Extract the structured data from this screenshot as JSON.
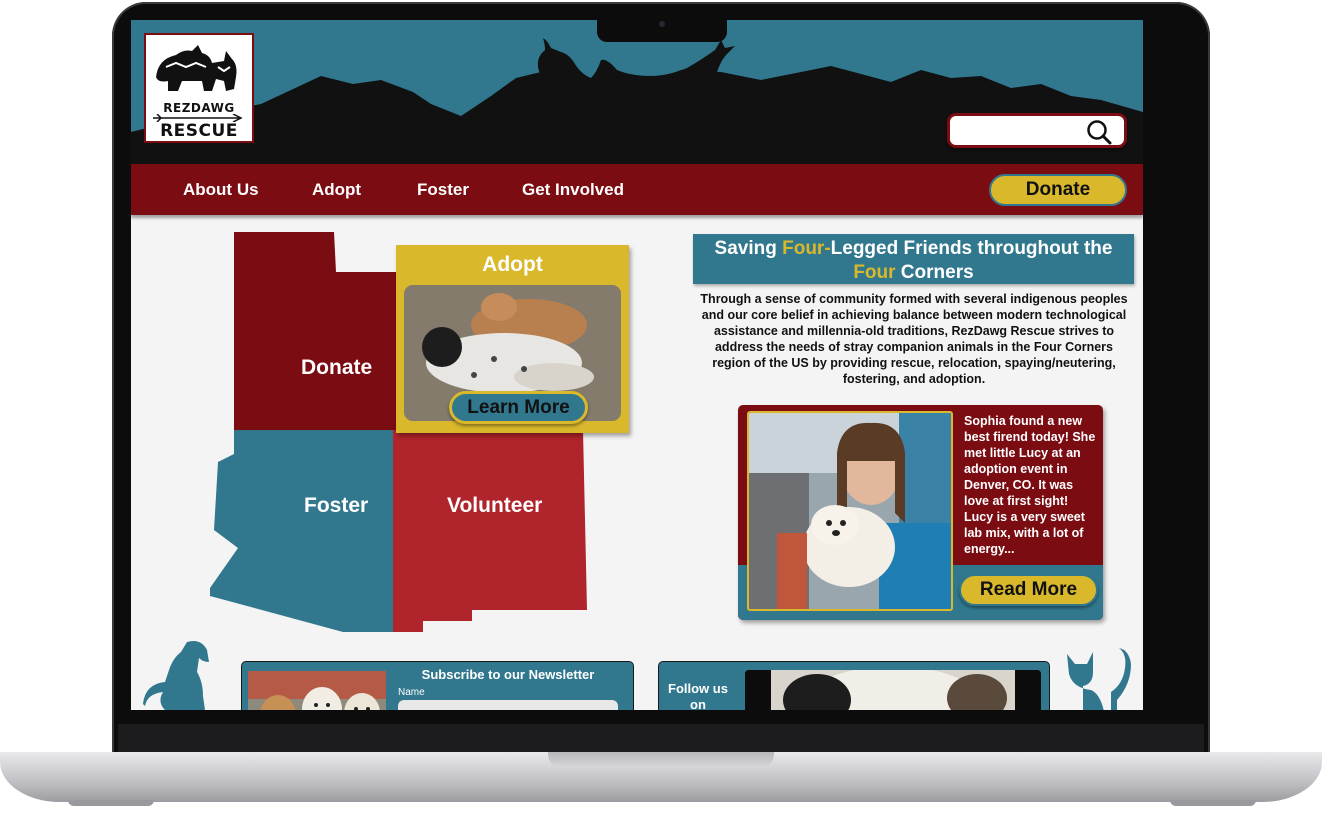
{
  "logo": {
    "line1": "REZDAWG",
    "line2": "RESCUE"
  },
  "search": {
    "placeholder": "",
    "value": ""
  },
  "nav": {
    "items": [
      "About Us",
      "Adopt",
      "Foster",
      "Get Involved"
    ],
    "donate": "Donate"
  },
  "map": {
    "donate": "Donate",
    "foster": "Foster",
    "volunteer": "Volunteer"
  },
  "adopt_card": {
    "title": "Adopt",
    "button": "Learn More"
  },
  "mission": {
    "title_part1": "Saving ",
    "title_hl1": "Four-",
    "title_part2": "Legged Friends throughout the ",
    "title_hl2": "Four",
    "title_part3": " Corners",
    "body": "Through a sense of community formed with several indigenous peoples and our core belief in achieving balance between modern technological assistance and millennia-old traditions, RezDawg Rescue strives to address the needs of stray companion animals in the Four Corners region of the US by providing rescue, relocation, spaying/neutering, fostering, and adoption."
  },
  "story": {
    "text": "Sophia found a new best firend today! She met little Lucy at an adoption event in Denver, CO.  It was love at first sight!  Lucy is a very sweet lab mix, with a lot of energy...",
    "button": "Read More"
  },
  "newsletter": {
    "title": "Subscribe to our Newsletter",
    "name_label": "Name"
  },
  "social": {
    "follow": "Follow us on"
  },
  "colors": {
    "red": "#7a0c12",
    "teal": "#31788f",
    "gold": "#d9b82b",
    "bright_red": "#b0242b"
  }
}
